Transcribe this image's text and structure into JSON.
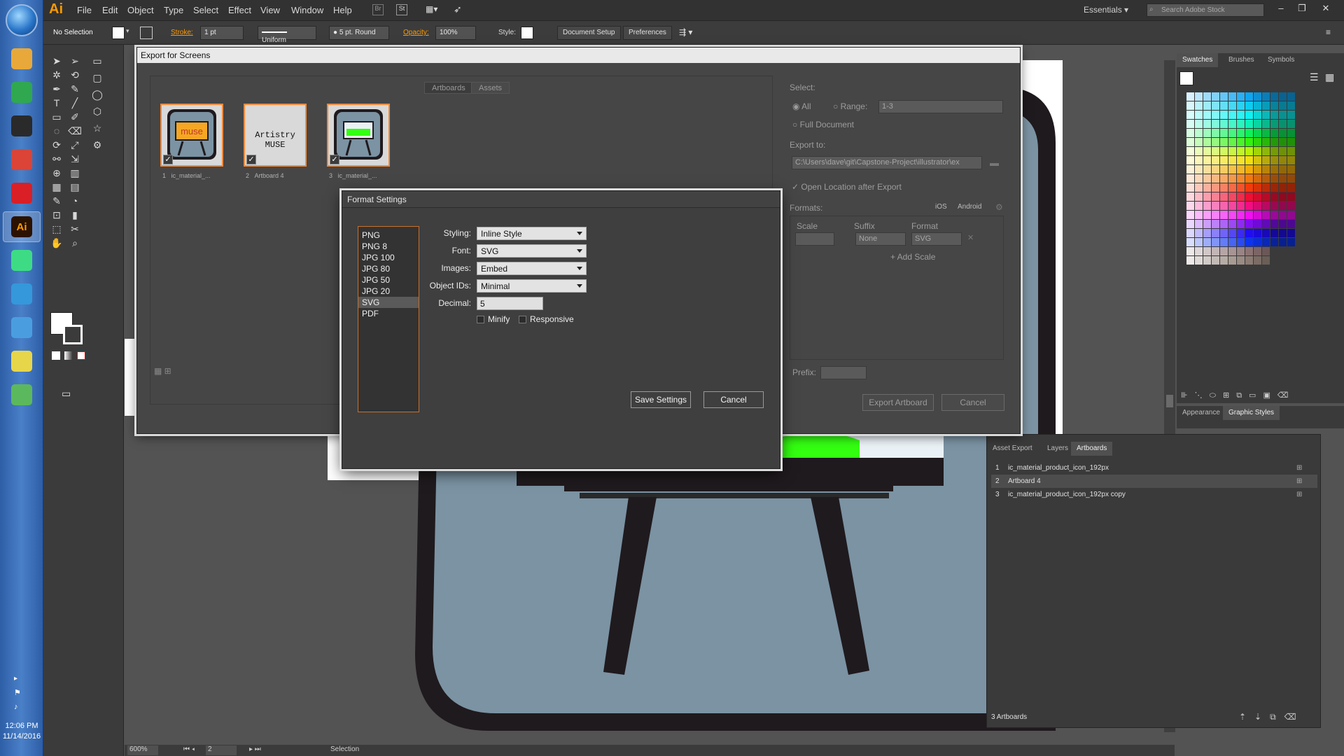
{
  "taskbar": {
    "apps": [
      {
        "icon": "file-explorer-icon",
        "color": "#e8a93a"
      },
      {
        "icon": "app-diamond-icon",
        "color": "#2fa84f"
      },
      {
        "icon": "github-icon",
        "color": "#2a2a2a"
      },
      {
        "icon": "chrome-icon",
        "color": "#db4437"
      },
      {
        "icon": "creative-cloud-icon",
        "color": "#da1f26"
      },
      {
        "icon": "illustrator-icon",
        "color": "#ff9a00",
        "active": true
      },
      {
        "icon": "android-studio-icon",
        "color": "#3ddc84"
      },
      {
        "icon": "xamarin-icon",
        "color": "#3498db"
      },
      {
        "icon": "smiley-icon",
        "color": "#4a9ee0"
      },
      {
        "icon": "sticky-notes-icon",
        "color": "#e8d64a"
      },
      {
        "icon": "book-icon",
        "color": "#5cb85c"
      }
    ],
    "time": "12:06 PM",
    "date": "11/14/2016"
  },
  "app": {
    "logo": "Ai",
    "menu": [
      "File",
      "Edit",
      "Object",
      "Type",
      "Select",
      "Effect",
      "View",
      "Window",
      "Help"
    ],
    "workspace": "Essentials",
    "search_placeholder": "Search Adobe Stock"
  },
  "control_bar": {
    "selection": "No Selection",
    "stroke_label": "Stroke:",
    "stroke_value": "1 pt",
    "profile": "Uniform",
    "brush": "5 pt. Round",
    "opacity_label": "Opacity:",
    "opacity_value": "100%",
    "style_label": "Style:",
    "document_setup": "Document Setup",
    "preferences": "Preferences"
  },
  "export_dialog": {
    "title": "Export for Screens",
    "tabs": [
      "Artboards",
      "Assets"
    ],
    "artboards": [
      {
        "num": "1",
        "label": "ic_material_...",
        "thumb_text": "muse",
        "checked": true
      },
      {
        "num": "2",
        "label": "Artboard 4",
        "thumb_text": "Artistry MUSE",
        "checked": true
      },
      {
        "num": "3",
        "label": "ic_material_...",
        "thumb_text": "",
        "checked": true
      }
    ],
    "select_label": "Select:",
    "all_label": "All",
    "range_label": "Range:",
    "range_value": "1-3",
    "full_document": "Full Document",
    "export_to_label": "Export to:",
    "export_path": "C:\\Users\\dave\\git\\Capstone-Project\\illustrator\\ex",
    "open_location": "Open Location after Export",
    "formats_label": "Formats:",
    "ios_label": "iOS",
    "android_label": "Android",
    "scale_header": "Scale",
    "suffix_header": "Suffix",
    "format_header": "Format",
    "suffix_value": "None",
    "format_value": "SVG",
    "add_scale": "+ Add Scale",
    "prefix_label": "Prefix:",
    "export_button": "Export Artboard",
    "cancel_button": "Cancel"
  },
  "format_dialog": {
    "title": "Format Settings",
    "formats": [
      "PNG",
      "PNG 8",
      "JPG 100",
      "JPG 80",
      "JPG 50",
      "JPG 20",
      "SVG",
      "PDF"
    ],
    "selected_format": "SVG",
    "styling_label": "Styling:",
    "styling_value": "Inline Style",
    "font_label": "Font:",
    "font_value": "SVG",
    "images_label": "Images:",
    "images_value": "Embed",
    "object_ids_label": "Object IDs:",
    "object_ids_value": "Minimal",
    "decimal_label": "Decimal:",
    "decimal_value": "5",
    "minify_label": "Minify",
    "responsive_label": "Responsive",
    "save_button": "Save Settings",
    "cancel_button": "Cancel"
  },
  "swatches_panel": {
    "tabs": [
      "Swatches",
      "Brushes",
      "Symbols"
    ]
  },
  "appearance_panel": {
    "tabs": [
      "Appearance",
      "Graphic Styles"
    ]
  },
  "artboards_panel": {
    "tabs": [
      "Asset Export",
      "Layers",
      "Artboards"
    ],
    "rows": [
      {
        "num": "1",
        "name": "ic_material_product_icon_192px"
      },
      {
        "num": "2",
        "name": "Artboard 4"
      },
      {
        "num": "3",
        "name": "ic_material_product_icon_192px copy"
      }
    ],
    "footer": "3 Artboards"
  },
  "status_bar": {
    "zoom": "600%",
    "artboard": "2",
    "mode": "Selection"
  },
  "colors": {
    "accent_orange": "#ff9a00",
    "easel_bg": "#7a93a3",
    "bright_green": "#33ff11"
  }
}
